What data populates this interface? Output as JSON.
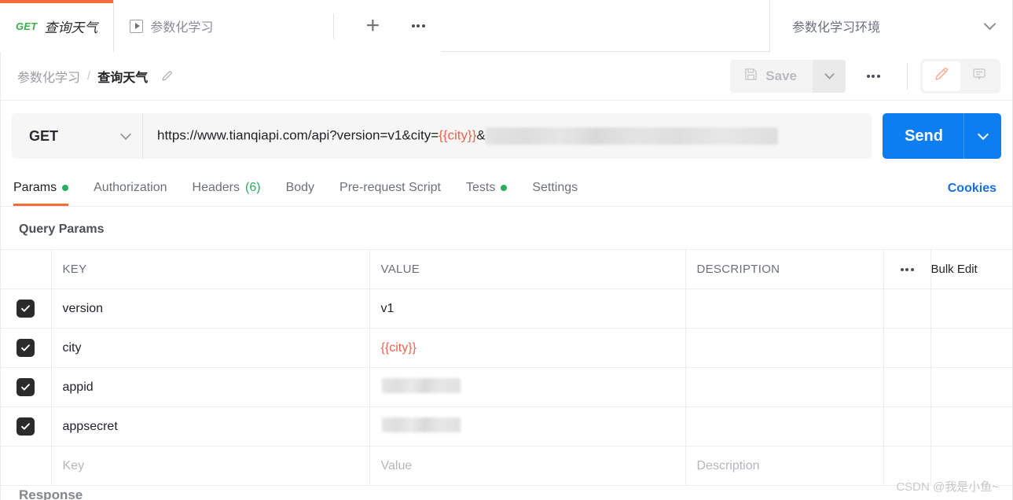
{
  "tabs": {
    "items": [
      {
        "method": "GET",
        "title": "查询天气",
        "active": true,
        "icon": null
      },
      {
        "method": null,
        "title": "参数化学习",
        "active": false,
        "icon": "runner-play-icon"
      }
    ],
    "new_tab_label": "+",
    "more_label": "more-options"
  },
  "environment": {
    "selected": "参数化学习环境",
    "chevron": "chevron-down-icon"
  },
  "breadcrumb": {
    "parent": "参数化学习",
    "separator": "/",
    "current": "查询天气",
    "edit_icon": "pencil-icon"
  },
  "toolbar": {
    "save_label": "Save",
    "save_icon": "floppy-disk-icon",
    "save_caret": "chevron-down-icon",
    "more_icon": "ellipsis-icon",
    "pencil_icon": "pencil-icon",
    "comment_icon": "comment-icon"
  },
  "request": {
    "method": "GET",
    "method_caret": "chevron-down-icon",
    "url_prefix": "https://www.tianqiapi.com/api?version=v1&city=",
    "url_variable": "{{city}}",
    "url_suffix": "&",
    "url_redacted": true,
    "send_label": "Send",
    "send_caret": "chevron-down-icon"
  },
  "request_tabs": {
    "items": [
      {
        "label": "Params",
        "badge_dot": true,
        "count": null,
        "active": true
      },
      {
        "label": "Authorization",
        "badge_dot": false,
        "count": null,
        "active": false
      },
      {
        "label": "Headers",
        "badge_dot": false,
        "count": "(6)",
        "active": false
      },
      {
        "label": "Body",
        "badge_dot": false,
        "count": null,
        "active": false
      },
      {
        "label": "Pre-request Script",
        "badge_dot": false,
        "count": null,
        "active": false
      },
      {
        "label": "Tests",
        "badge_dot": true,
        "count": null,
        "active": false
      },
      {
        "label": "Settings",
        "badge_dot": false,
        "count": null,
        "active": false
      }
    ],
    "cookies_label": "Cookies"
  },
  "query_params": {
    "section_title": "Query Params",
    "columns": {
      "key": "KEY",
      "value": "VALUE",
      "description": "DESCRIPTION",
      "options_icon": "ellipsis-icon",
      "bulk_edit": "Bulk Edit"
    },
    "rows": [
      {
        "checked": true,
        "key": "version",
        "value": "v1",
        "value_kind": "plain",
        "description": ""
      },
      {
        "checked": true,
        "key": "city",
        "value": "{{city}}",
        "value_kind": "variable",
        "description": ""
      },
      {
        "checked": true,
        "key": "appid",
        "value": "",
        "value_kind": "redacted",
        "description": ""
      },
      {
        "checked": true,
        "key": "appsecret",
        "value": "",
        "value_kind": "redacted",
        "description": ""
      }
    ],
    "placeholder_row": {
      "key": "Key",
      "value": "Value",
      "description": "Description"
    }
  },
  "response": {
    "label": "Response"
  },
  "watermark": {
    "text": "CSDN @我是小鱼~"
  },
  "colors": {
    "accent_orange": "#f26b3a",
    "send_blue": "#0d7df2",
    "variable_orange": "#f0634a",
    "method_green": "#3dad4d",
    "badge_green": "#27ae60",
    "link_blue": "#1a6fe0"
  }
}
